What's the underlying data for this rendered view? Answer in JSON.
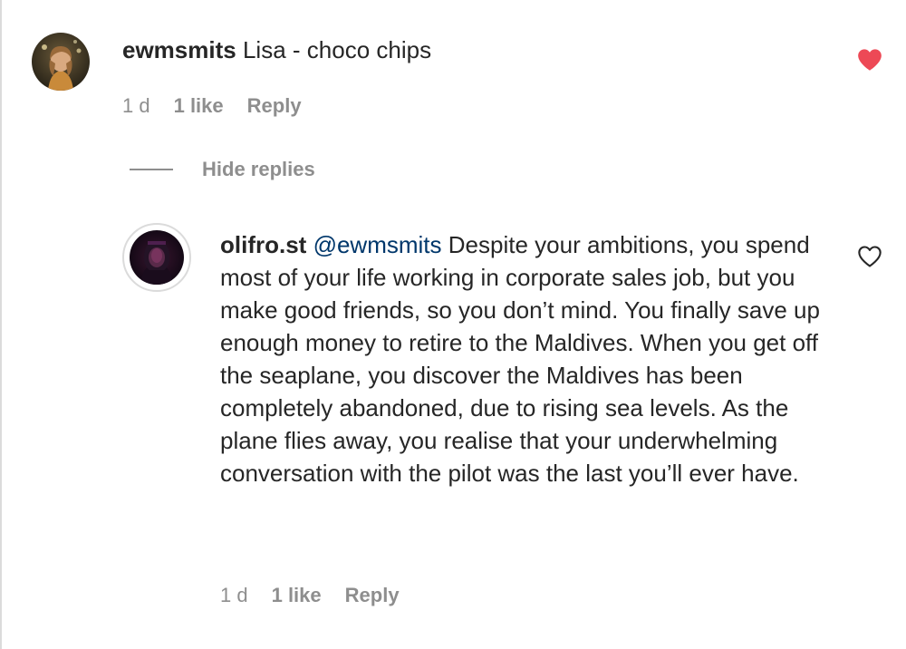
{
  "colors": {
    "text": "#262626",
    "secondary": "#8e8e8e",
    "mention": "#00376b",
    "liked_heart": "#ed4956"
  },
  "comments": [
    {
      "username": "ewmsmits",
      "mention": "",
      "text": "Lisa - choco chips",
      "time": "1 d",
      "likes": "1 like",
      "reply_label": "Reply",
      "liked": true,
      "heart_icon": "heart-filled-icon"
    },
    {
      "username": "olifro.st",
      "mention": "@ewmsmits",
      "text": "Despite your ambitions, you spend most of your life working in corporate sales job, but you make good friends, so you don’t mind. You finally save up enough money to retire to the Maldives. When you get off the seaplane, you discover the Maldives has been completely abandoned, due to rising sea levels. As the plane flies away, you realise that your underwhelming conversation with the pilot was the last you’ll ever have.",
      "time": "1 d",
      "likes": "1 like",
      "reply_label": "Reply",
      "liked": false,
      "heart_icon": "heart-outline-icon"
    }
  ],
  "hide_replies_label": "Hide replies"
}
